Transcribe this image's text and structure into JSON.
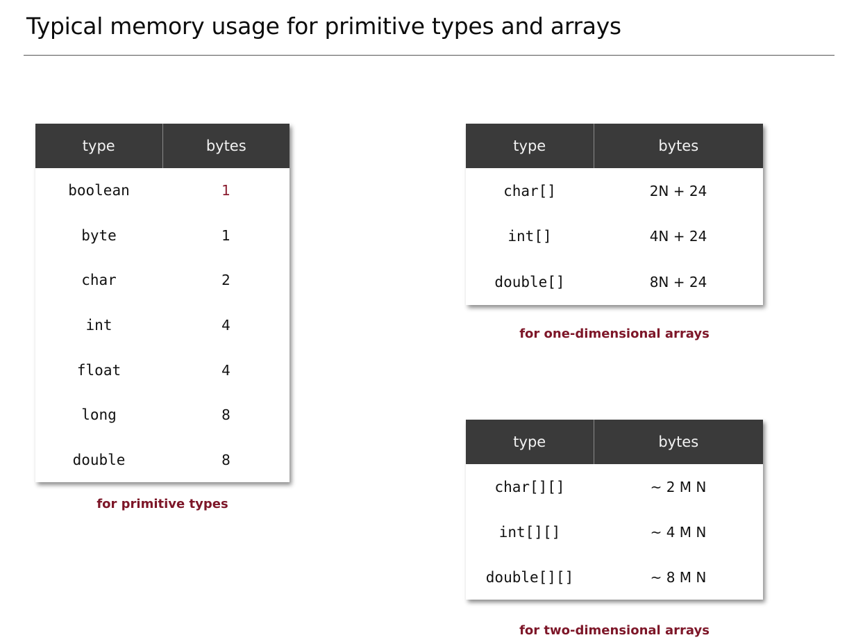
{
  "title": "Typical memory usage for primitive types and arrays",
  "colors": {
    "header_bg": "#3a3a3a",
    "header_text": "#f2f2f2",
    "caption": "#7d1628",
    "highlight_value": "#8a1b2e"
  },
  "primitive_table": {
    "headers": [
      "type",
      "bytes"
    ],
    "rows": [
      {
        "type": "boolean",
        "bytes": "1"
      },
      {
        "type": "byte",
        "bytes": "1"
      },
      {
        "type": "char",
        "bytes": "2"
      },
      {
        "type": "int",
        "bytes": "4"
      },
      {
        "type": "float",
        "bytes": "4"
      },
      {
        "type": "long",
        "bytes": "8"
      },
      {
        "type": "double",
        "bytes": "8"
      }
    ],
    "caption": "for primitive types"
  },
  "one_dim_table": {
    "headers": [
      "type",
      "bytes"
    ],
    "rows": [
      {
        "type": "char[]",
        "bytes": "2N + 24"
      },
      {
        "type": "int[]",
        "bytes": "4N + 24"
      },
      {
        "type": "double[]",
        "bytes": "8N + 24"
      }
    ],
    "caption": "for one-dimensional arrays"
  },
  "two_dim_table": {
    "headers": [
      "type",
      "bytes"
    ],
    "rows": [
      {
        "type": "char[][]",
        "bytes": "~ 2 M N"
      },
      {
        "type": "int[][]",
        "bytes": "~ 4 M N"
      },
      {
        "type": "double[][]",
        "bytes": "~ 8 M N"
      }
    ],
    "caption": "for two-dimensional arrays"
  }
}
